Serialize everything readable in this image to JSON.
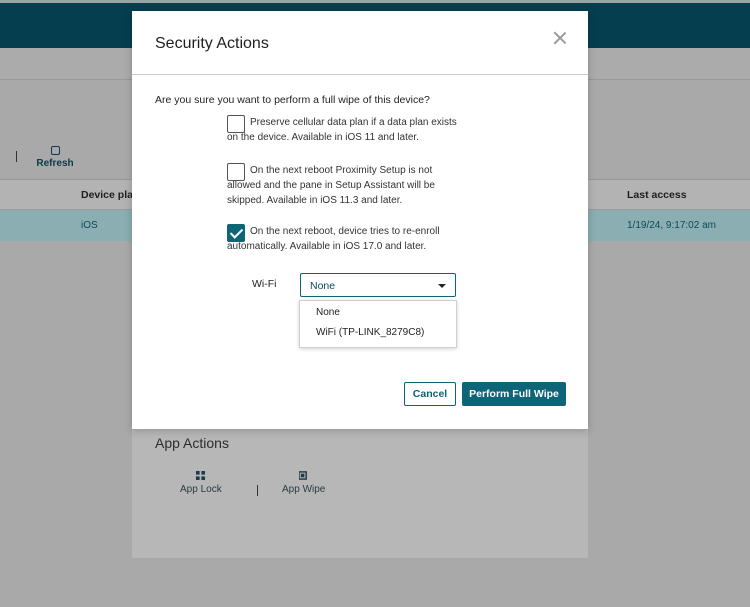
{
  "background": {
    "toolbar": {
      "refresh_label": "Refresh"
    },
    "table": {
      "headers": {
        "device_platform": "Device plat",
        "last_access": "Last access"
      },
      "row": {
        "platform": "iOS",
        "last_access": "1/19/24, 9:17:02 am"
      }
    },
    "app_actions": {
      "title": "App Actions",
      "app_lock_label": "App Lock",
      "app_wipe_label": "App Wipe"
    }
  },
  "modal": {
    "title": "Security Actions",
    "question": "Are you sure you want to perform a full wipe of this device?",
    "options": [
      {
        "text": "Preserve cellular data plan if a data plan exists on the device. Available in iOS 11 and later.",
        "checked": false
      },
      {
        "text": "On the next reboot Proximity Setup is not allowed and the pane in Setup Assistant will be skipped. Available in iOS 11.3 and later.",
        "checked": false
      },
      {
        "text": "On the next reboot, device tries to re-enroll automatically. Available in iOS 17.0 and later.",
        "checked": true
      }
    ],
    "wifi": {
      "label": "Wi-Fi",
      "selected": "None",
      "options": [
        "None",
        "WiFi (TP-LINK_8279C8)"
      ]
    },
    "buttons": {
      "cancel": "Cancel",
      "confirm": "Perform Full Wipe"
    }
  },
  "colors": {
    "accent": "#0e6578",
    "topbar": "#053f4f",
    "overlay_page": "#a9a9a9"
  }
}
